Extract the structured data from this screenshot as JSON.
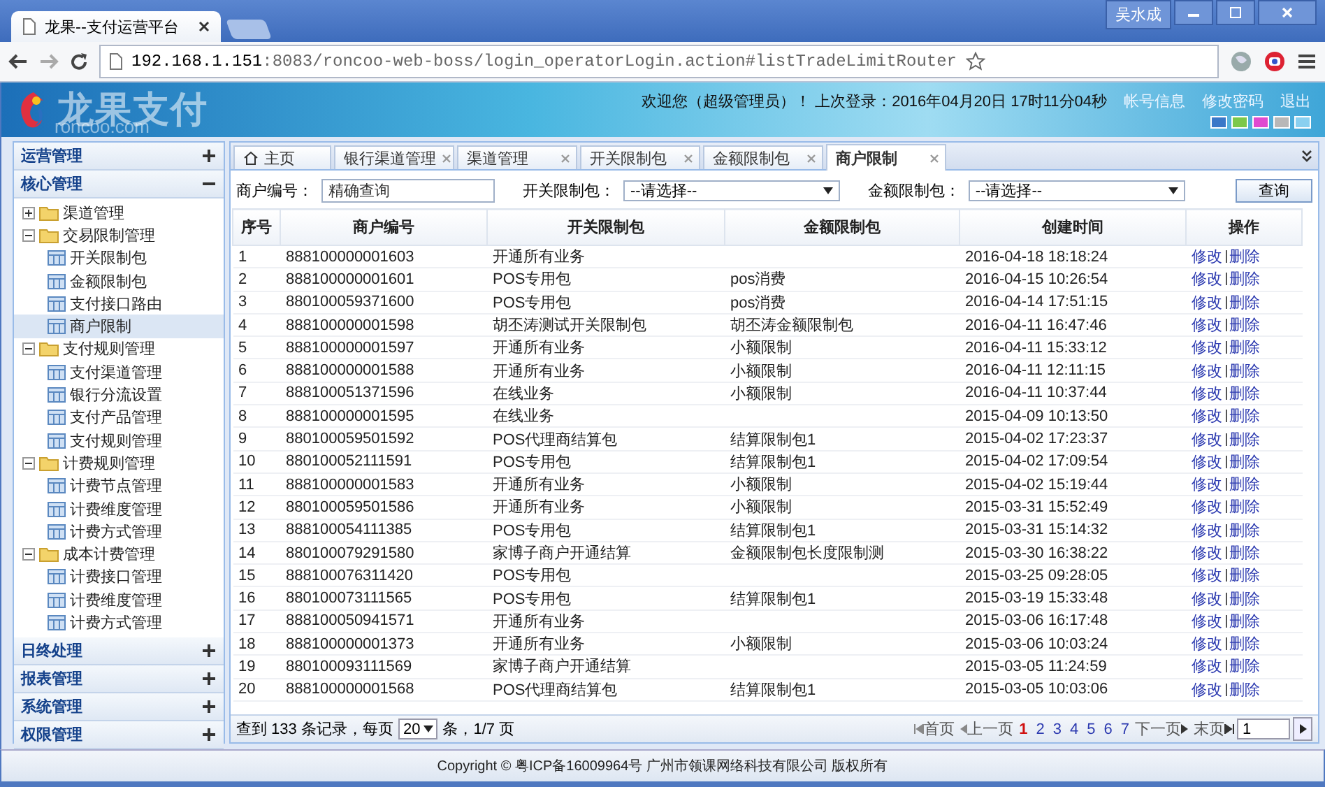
{
  "browser": {
    "tab_title": "龙果--支付运营平台",
    "user": "吴水成",
    "url_host": "192.168.1.151",
    "url_rest": ":8083/roncoo-web-boss/login_operatorLogin.action#listTradeLimitRouter"
  },
  "header": {
    "logo_text": "龙果支付",
    "logo_subtext": "roncoo.com",
    "welcome": "欢迎您（超级管理员）！ 上次登录：2016年04月20日 17时11分04秒",
    "links": [
      "帐号信息",
      "修改密码",
      "退出"
    ],
    "themes": [
      {
        "color": "#3a78c8"
      },
      {
        "color": "#7cc84a"
      },
      {
        "color": "#e04ad0"
      },
      {
        "color": "#b8b8b8"
      },
      {
        "color": "#8ad0f0"
      }
    ]
  },
  "sidebar": {
    "sections": [
      {
        "label": "运营管理",
        "expanded": false
      },
      {
        "label": "核心管理",
        "expanded": true,
        "children": [
          {
            "label": "渠道管理",
            "kind": "folder",
            "expanded": false
          },
          {
            "label": "交易限制管理",
            "kind": "folder",
            "expanded": true,
            "children": [
              {
                "label": "开关限制包",
                "kind": "page",
                "selected": false
              },
              {
                "label": "金额限制包",
                "kind": "page",
                "selected": false
              },
              {
                "label": "支付接口路由",
                "kind": "page",
                "selected": false
              },
              {
                "label": "商户限制",
                "kind": "page",
                "selected": true
              }
            ]
          },
          {
            "label": "支付规则管理",
            "kind": "folder",
            "expanded": true,
            "children": [
              {
                "label": "支付渠道管理",
                "kind": "page",
                "selected": false
              },
              {
                "label": "银行分流设置",
                "kind": "page",
                "selected": false
              },
              {
                "label": "支付产品管理",
                "kind": "page",
                "selected": false
              },
              {
                "label": "支付规则管理",
                "kind": "page",
                "selected": false
              }
            ]
          },
          {
            "label": "计费规则管理",
            "kind": "folder",
            "expanded": true,
            "children": [
              {
                "label": "计费节点管理",
                "kind": "page",
                "selected": false
              },
              {
                "label": "计费维度管理",
                "kind": "page",
                "selected": false
              },
              {
                "label": "计费方式管理",
                "kind": "page",
                "selected": false
              }
            ]
          },
          {
            "label": "成本计费管理",
            "kind": "folder",
            "expanded": true,
            "children": [
              {
                "label": "计费接口管理",
                "kind": "page",
                "selected": false
              },
              {
                "label": "计费维度管理",
                "kind": "page",
                "selected": false
              },
              {
                "label": "计费方式管理",
                "kind": "page",
                "selected": false
              }
            ]
          }
        ]
      },
      {
        "label": "日终处理",
        "expanded": false
      },
      {
        "label": "报表管理",
        "expanded": false
      },
      {
        "label": "系统管理",
        "expanded": false
      },
      {
        "label": "权限管理",
        "expanded": false
      }
    ]
  },
  "tabs": [
    {
      "label": "主页",
      "kind": "home",
      "selected": false
    },
    {
      "label": "银行渠道管理",
      "kind": "page",
      "selected": false
    },
    {
      "label": "渠道管理",
      "kind": "page",
      "selected": false
    },
    {
      "label": "开关限制包",
      "kind": "page",
      "selected": false
    },
    {
      "label": "金额限制包",
      "kind": "page",
      "selected": false
    },
    {
      "label": "商户限制",
      "kind": "page",
      "selected": true
    }
  ],
  "filters": {
    "merchant": {
      "label": "商户编号：",
      "placeholder": "精确查询"
    },
    "selects": [
      {
        "label": "开关限制包：",
        "value": "--请选择--"
      },
      {
        "label": "金额限制包：",
        "value": "--请选择--"
      }
    ],
    "button": "查询"
  },
  "table": {
    "columns": [
      "序号",
      "商户编号",
      "开关限制包",
      "金额限制包",
      "创建时间",
      "操作"
    ],
    "rows": [
      {
        "no": "1",
        "merchant": "888100000001603",
        "switch_pack": "开通所有业务",
        "created": "2016-04-18 18:18:24",
        "actions": [
          "修改",
          "删除"
        ]
      },
      {
        "no": "2",
        "merchant": "888100000001601",
        "switch_pack": "POS专用包",
        "amount_pack": "pos消费",
        "created": "2016-04-15 10:26:54",
        "actions": [
          "修改",
          "删除"
        ]
      },
      {
        "no": "3",
        "merchant": "880100059371600",
        "switch_pack": "POS专用包",
        "amount_pack": "pos消费",
        "created": "2016-04-14 17:51:15",
        "actions": [
          "修改",
          "删除"
        ]
      },
      {
        "no": "4",
        "merchant": "888100000001598",
        "switch_pack": "胡丕涛测试开关限制包",
        "amount_pack": "胡丕涛金额限制包",
        "created": "2016-04-11 16:47:46",
        "actions": [
          "修改",
          "删除"
        ]
      },
      {
        "no": "5",
        "merchant": "888100000001597",
        "switch_pack": "开通所有业务",
        "amount_pack": "小额限制",
        "created": "2016-04-11 15:33:12",
        "actions": [
          "修改",
          "删除"
        ]
      },
      {
        "no": "6",
        "merchant": "888100000001588",
        "switch_pack": "开通所有业务",
        "amount_pack": "小额限制",
        "created": "2016-04-11 12:11:15",
        "actions": [
          "修改",
          "删除"
        ]
      },
      {
        "no": "7",
        "merchant": "888100051371596",
        "switch_pack": "在线业务",
        "amount_pack": "小额限制",
        "created": "2016-04-11 10:37:44",
        "actions": [
          "修改",
          "删除"
        ]
      },
      {
        "no": "8",
        "merchant": "888100000001595",
        "switch_pack": "在线业务",
        "created": "2015-04-09 10:13:50",
        "actions": [
          "修改",
          "删除"
        ]
      },
      {
        "no": "9",
        "merchant": "880100059501592",
        "switch_pack": "POS代理商结算包",
        "amount_pack": "结算限制包1",
        "created": "2015-04-02 17:23:37",
        "actions": [
          "修改",
          "删除"
        ]
      },
      {
        "no": "10",
        "merchant": "880100052111591",
        "switch_pack": "POS专用包",
        "amount_pack": "结算限制包1",
        "created": "2015-04-02 17:09:54",
        "actions": [
          "修改",
          "删除"
        ]
      },
      {
        "no": "11",
        "merchant": "888100000001583",
        "switch_pack": "开通所有业务",
        "amount_pack": "小额限制",
        "created": "2015-04-02 15:19:44",
        "actions": [
          "修改",
          "删除"
        ]
      },
      {
        "no": "12",
        "merchant": "880100059501586",
        "switch_pack": "开通所有业务",
        "amount_pack": "小额限制",
        "created": "2015-03-31 15:52:49",
        "actions": [
          "修改",
          "删除"
        ]
      },
      {
        "no": "13",
        "merchant": "888100054111385",
        "switch_pack": "POS专用包",
        "amount_pack": "结算限制包1",
        "created": "2015-03-31 15:14:32",
        "actions": [
          "修改",
          "删除"
        ]
      },
      {
        "no": "14",
        "merchant": "880100079291580",
        "switch_pack": "家博子商户开通结算",
        "amount_pack": "金额限制包长度限制测",
        "created": "2015-03-30 16:38:22",
        "actions": [
          "修改",
          "删除"
        ]
      },
      {
        "no": "15",
        "merchant": "888100076311420",
        "switch_pack": "POS专用包",
        "created": "2015-03-25 09:28:05",
        "actions": [
          "修改",
          "删除"
        ]
      },
      {
        "no": "16",
        "merchant": "880100073111565",
        "switch_pack": "POS专用包",
        "amount_pack": "结算限制包1",
        "created": "2015-03-19 15:33:48",
        "actions": [
          "修改",
          "删除"
        ]
      },
      {
        "no": "17",
        "merchant": "888100050941571",
        "switch_pack": "开通所有业务",
        "created": "2015-03-06 16:17:48",
        "actions": [
          "修改",
          "删除"
        ]
      },
      {
        "no": "18",
        "merchant": "888100000001373",
        "switch_pack": "开通所有业务",
        "amount_pack": "小额限制",
        "created": "2015-03-06 10:03:24",
        "actions": [
          "修改",
          "删除"
        ]
      },
      {
        "no": "19",
        "merchant": "880100093111569",
        "switch_pack": "家博子商户开通结算",
        "created": "2015-03-05 11:24:59",
        "actions": [
          "修改",
          "删除"
        ]
      },
      {
        "no": "20",
        "merchant": "888100000001568",
        "switch_pack": "POS代理商结算包",
        "amount_pack": "结算限制包1",
        "created": "2015-03-05 10:03:06",
        "actions": [
          "修改",
          "删除"
        ]
      }
    ]
  },
  "pager": {
    "summary_before": "查到 133 条记录，每页",
    "page_size": "20",
    "summary_after": "条，1/7 页",
    "first": "首页",
    "prev": "上一页",
    "pages": [
      {
        "label": "1",
        "selected": true
      },
      {
        "label": "2",
        "selected": false
      },
      {
        "label": "3",
        "selected": false
      },
      {
        "label": "4",
        "selected": false
      },
      {
        "label": "5",
        "selected": false
      },
      {
        "label": "6",
        "selected": false
      },
      {
        "label": "7",
        "selected": false
      }
    ],
    "next": "下一页",
    "last": "末页",
    "goto_value": "1"
  },
  "footer": "Copyright © 粤ICP备16009964号 广州市领课网络科技有限公司 版权所有"
}
